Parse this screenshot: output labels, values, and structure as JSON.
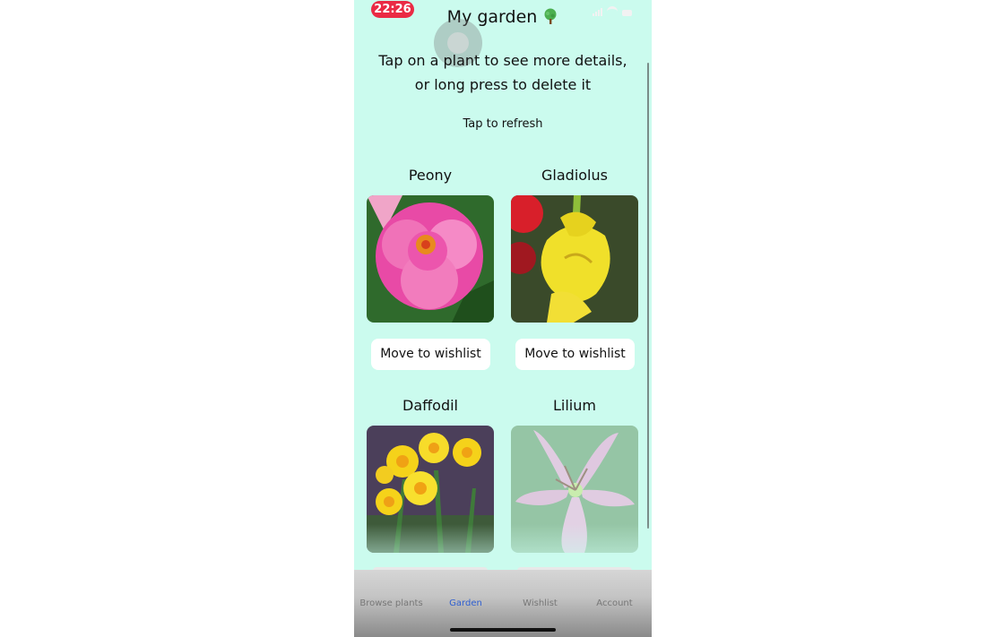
{
  "status_bar": {
    "time": "22:26"
  },
  "header": {
    "title": "My garden"
  },
  "instructions": {
    "line1": "Tap on a plant to see more details,",
    "line2": "or long press to delete it"
  },
  "refresh_label": "Tap to refresh",
  "plants": [
    {
      "name": "Peony",
      "button": "Move to wishlist"
    },
    {
      "name": "Gladiolus",
      "button": "Move to wishlist"
    },
    {
      "name": "Daffodil"
    },
    {
      "name": "Lilium"
    }
  ],
  "tabs": [
    {
      "label": "Browse plants",
      "active": false
    },
    {
      "label": "Garden",
      "active": true
    },
    {
      "label": "Wishlist",
      "active": false
    },
    {
      "label": "Account",
      "active": false
    }
  ],
  "colors": {
    "background": "#cbfbee",
    "status_time_badge": "#ea2a44",
    "active_tab": "#2f5fd0"
  }
}
